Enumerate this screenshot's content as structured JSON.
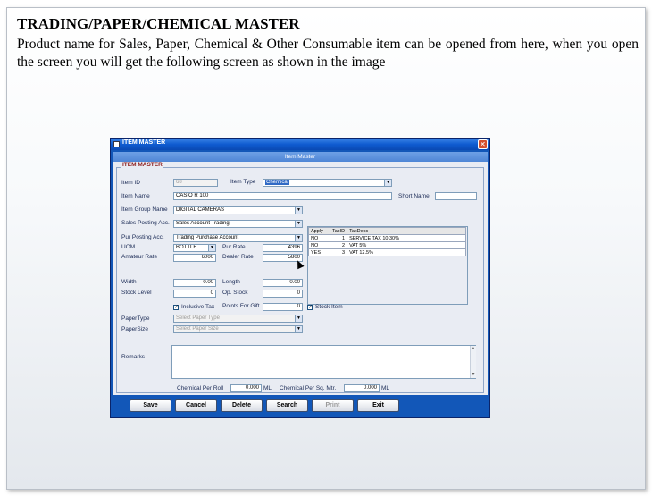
{
  "doc": {
    "title": "TRADING/PAPER/CHEMICAL MASTER",
    "body": "Product name for Sales, Paper, Chemical & Other Consumable item can be opened from here, when you open the screen you will get the following screen as shown in the image"
  },
  "window": {
    "title": "ITEM MASTER",
    "close": "✕",
    "form_title": "Item Master",
    "group_label": "ITEM MASTER"
  },
  "fields": {
    "item_id": {
      "label": "Item ID",
      "value": "68"
    },
    "item_type": {
      "label": "Item Type",
      "value": "Chemical"
    },
    "item_name": {
      "label": "Item Name",
      "value": "CASIO R 100"
    },
    "short_name": {
      "label": "Short Name",
      "value": ""
    },
    "item_group": {
      "label": "Item Group Name",
      "value": "DIGITAL CAMERAS"
    },
    "sales_posting": {
      "label": "Sales Posting Acc.",
      "value": "Sales Account Trading"
    },
    "pur_posting": {
      "label": "Pur Posting Acc.",
      "value": "Trading Purchase Account"
    },
    "uom": {
      "label": "UOM",
      "value": "BOTTLE"
    },
    "pur_rate": {
      "label": "Pur Rate",
      "value": "4396"
    },
    "amateur_rate": {
      "label": "Amateur Rate",
      "value": "6000"
    },
    "dealer_rate": {
      "label": "Dealer Rate",
      "value": "5800"
    },
    "width": {
      "label": "Width",
      "value": "0.00"
    },
    "length": {
      "label": "Length",
      "value": "0.00"
    },
    "stock_level": {
      "label": "Stock Level",
      "value": "0"
    },
    "op_stock": {
      "label": "Op. Stock",
      "value": "0"
    },
    "inclusive_tax": {
      "label": "Inclusive Tax",
      "checked": "✓"
    },
    "points_for_gift": {
      "label": "Points For Gift",
      "value": "0"
    },
    "stock_item": {
      "label": "Stock Item",
      "checked": "✓"
    },
    "paper_type": {
      "label": "PaperType",
      "placeholder": "Select Paper Type"
    },
    "paper_size": {
      "label": "PaperSize",
      "placeholder": "Select Paper Size"
    },
    "remarks": {
      "label": "Remarks",
      "value": ""
    },
    "chem_per_roll": {
      "label": "Chemical Per Roll",
      "value": "0.000",
      "unit": "ML"
    },
    "chem_per_sqm": {
      "label": "Chemical Per Sq. Mtr.",
      "value": "0.000",
      "unit": "ML"
    }
  },
  "tax_grid": {
    "headers": [
      "Apply",
      "TaxID",
      "TaxDesc"
    ],
    "rows": [
      [
        "NO",
        "1",
        "SERVICE TAX 10.30%"
      ],
      [
        "NO",
        "2",
        "VAT 5%"
      ],
      [
        "YES",
        "3",
        "VAT 12.5%"
      ]
    ]
  },
  "buttons": [
    {
      "label": "Save"
    },
    {
      "label": "Cancel"
    },
    {
      "label": "Delete"
    },
    {
      "label": "Search"
    },
    {
      "label": "Print"
    },
    {
      "label": "Exit"
    }
  ],
  "icons": {
    "dropdown": "▼",
    "scroll_up": "▲",
    "scroll_down": "▼"
  }
}
